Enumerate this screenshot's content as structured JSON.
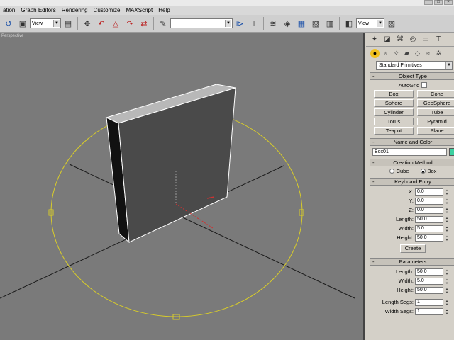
{
  "menu": {
    "items": [
      "ation",
      "Graph Editors",
      "Rendering",
      "Customize",
      "MAXScript",
      "Help"
    ]
  },
  "toolbar": {
    "reference_coord": "View",
    "selection_set": "",
    "view_right": "View"
  },
  "viewport": {
    "label": "Perspective"
  },
  "command_panel": {
    "primitive_type": "Standard Primitives",
    "object_type": {
      "title": "Object Type",
      "autogrid": "AutoGrid",
      "buttons": [
        "Box",
        "Cone",
        "Sphere",
        "GeoSphere",
        "Cylinder",
        "Tube",
        "Torus",
        "Pyramid",
        "Teapot",
        "Plane"
      ]
    },
    "name_color": {
      "title": "Name and Color",
      "name": "Box01",
      "color": "#3cd0a0"
    },
    "creation_method": {
      "title": "Creation Method",
      "cube": "Cube",
      "box": "Box",
      "selected": "Box"
    },
    "keyboard_entry": {
      "title": "Keyboard Entry",
      "x_label": "X:",
      "x": "0.0",
      "y_label": "Y:",
      "y": "0.0",
      "z_label": "Z:",
      "z": "0.0",
      "length_label": "Length:",
      "length": "50.0",
      "width_label": "Width:",
      "width": "5.0",
      "height_label": "Height:",
      "height": "50.0",
      "create": "Create"
    },
    "parameters": {
      "title": "Parameters",
      "length_label": "Length:",
      "length": "50.0",
      "width_label": "Width:",
      "width": "5.0",
      "height_label": "Height:",
      "height": "50.0",
      "length_segs_label": "Length Segs:",
      "length_segs": "1",
      "width_segs_label": "Width Segs:",
      "width_segs": "1"
    }
  }
}
